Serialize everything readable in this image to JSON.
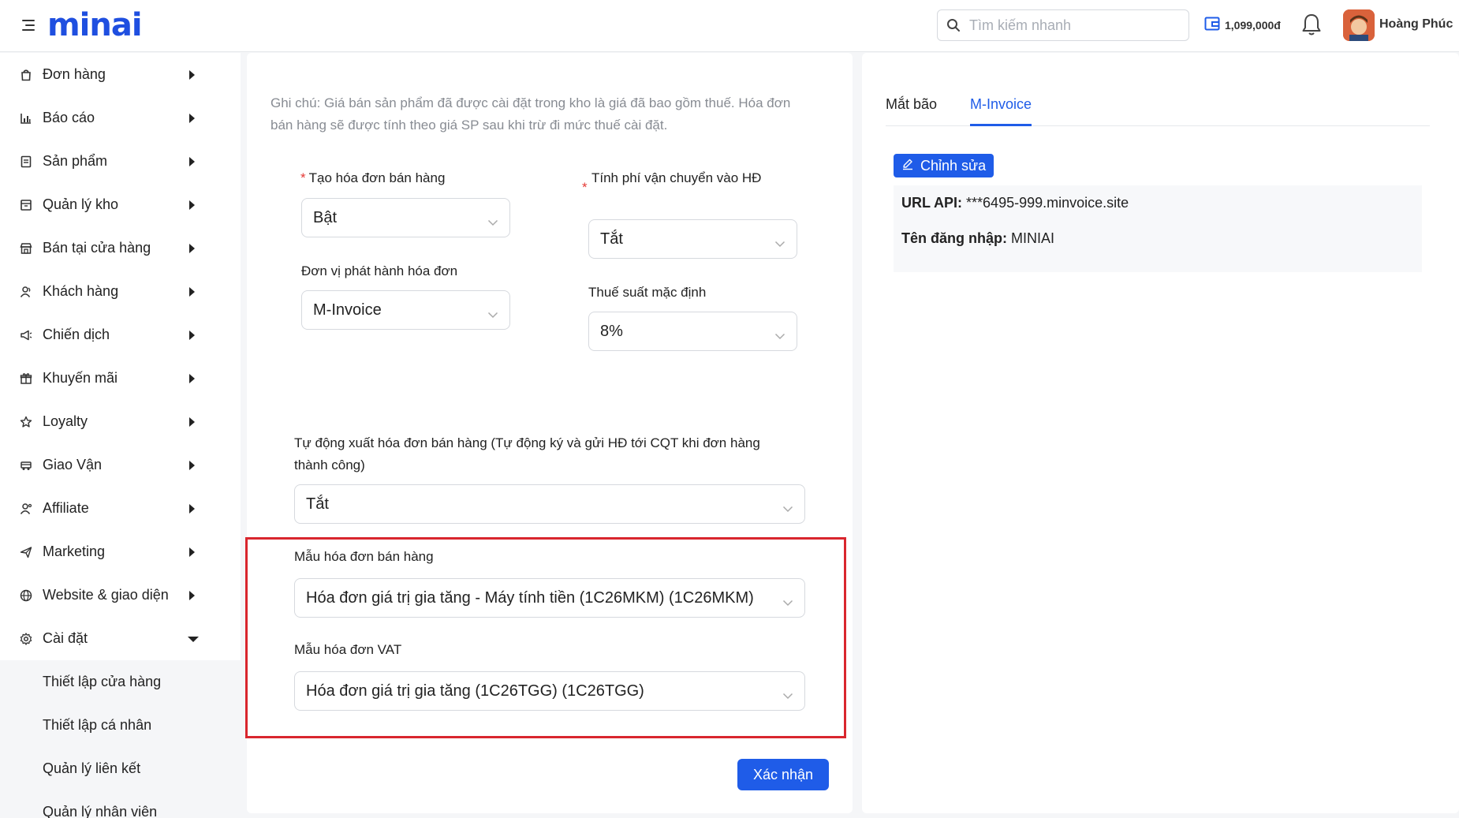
{
  "header": {
    "logo": "minai",
    "search_placeholder": "Tìm kiếm nhanh",
    "wallet_balance": "1,099,000đ",
    "user_name": "Hoàng Phúc"
  },
  "sidebar": {
    "items": [
      {
        "label": "Đơn hàng"
      },
      {
        "label": "Báo cáo"
      },
      {
        "label": "Sản phẩm"
      },
      {
        "label": "Quản lý kho"
      },
      {
        "label": "Bán tại cửa hàng"
      },
      {
        "label": "Khách hàng"
      },
      {
        "label": "Chiến dịch"
      },
      {
        "label": "Khuyến mãi"
      },
      {
        "label": "Loyalty"
      },
      {
        "label": "Giao Vận"
      },
      {
        "label": "Affiliate"
      },
      {
        "label": "Marketing"
      },
      {
        "label": "Website & giao diện"
      },
      {
        "label": "Cài đặt"
      }
    ],
    "sub_items": [
      {
        "label": "Thiết lập cửa hàng"
      },
      {
        "label": "Thiết lập cá nhân"
      },
      {
        "label": "Quản lý liên kết"
      },
      {
        "label": "Quản lý nhân viên"
      }
    ]
  },
  "form": {
    "note": "Ghi chú: Giá bán sản phẩm đã được cài đặt trong kho là giá đã bao gồm thuế. Hóa đơn bán hàng sẽ được tính theo giá SP sau khi trừ đi mức thuế cài đặt.",
    "create_invoice_label": "Tạo hóa đơn bán hàng",
    "create_invoice_value": "Bật",
    "shipping_fee_label": "Tính phí vận chuyển vào HĐ",
    "shipping_fee_value": "Tắt",
    "issuer_label": "Đơn vị phát hành hóa đơn",
    "issuer_value": "M-Invoice",
    "tax_rate_label": "Thuế suất mặc định",
    "tax_rate_value": "8%",
    "auto_export_label": "Tự động xuất hóa đơn bán hàng (Tự động ký và gửi HĐ tới CQT khi đơn hàng thành công)",
    "auto_export_value": "Tắt",
    "sales_template_label": "Mẫu hóa đơn bán hàng",
    "sales_template_value": "Hóa đơn giá trị gia tăng - Máy tính tiền (1C26MKM) (1C26MKM)",
    "vat_template_label": "Mẫu hóa đơn VAT",
    "vat_template_value": "Hóa đơn giá trị gia tăng (1C26TGG) (1C26TGG)",
    "confirm_label": "Xác nhận"
  },
  "right_panel": {
    "tabs": [
      {
        "label": "Mắt bão",
        "active": false
      },
      {
        "label": "M-Invoice",
        "active": true
      }
    ],
    "edit_label": "Chỉnh sửa",
    "url_api_label": "URL API:",
    "url_api_value": "***6495-999.minvoice.site",
    "username_label": "Tên đăng nhập:",
    "username_value": "MINIAI"
  },
  "colors": {
    "brand": "#1f4fe0",
    "primary": "#1f5ce8",
    "highlight": "#d9262e",
    "required": "#e53935"
  }
}
